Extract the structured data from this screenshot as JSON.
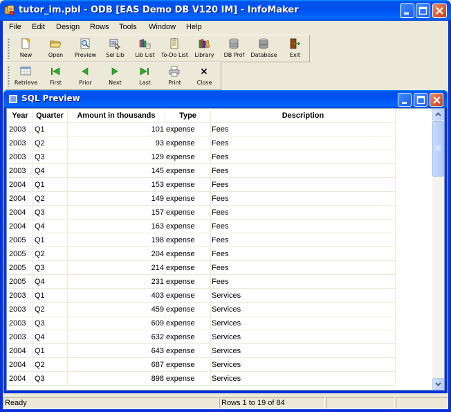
{
  "app": {
    "title": "tutor_im.pbl - ODB [EAS Demo DB V120 IM] - InfoMaker"
  },
  "menu": [
    "File",
    "Edit",
    "Design",
    "Rows",
    "Tools",
    "Window",
    "Help"
  ],
  "toolbar1": [
    {
      "label": "New",
      "icon": "new-icon"
    },
    {
      "label": "Open",
      "icon": "open-folder-icon"
    },
    {
      "label": "Preview",
      "icon": "preview-icon"
    },
    {
      "label": "Sel Lib",
      "icon": "select-library-icon"
    },
    {
      "label": "Lib List",
      "icon": "library-list-icon"
    },
    {
      "label": "To-Do List",
      "icon": "todo-list-icon"
    },
    {
      "label": "Library",
      "icon": "library-icon"
    },
    {
      "label": "DB Prof",
      "icon": "db-profile-icon"
    },
    {
      "label": "Database",
      "icon": "database-icon"
    },
    {
      "label": "Exit",
      "icon": "exit-door-icon"
    }
  ],
  "toolbar2": [
    {
      "label": "Retrieve",
      "icon": "retrieve-icon"
    },
    {
      "label": "First",
      "icon": "first-arrow-icon"
    },
    {
      "label": "Prior",
      "icon": "prior-arrow-icon"
    },
    {
      "label": "Next",
      "icon": "next-arrow-icon"
    },
    {
      "label": "Last",
      "icon": "last-arrow-icon"
    },
    {
      "label": "Print",
      "icon": "printer-icon"
    },
    {
      "label": "Close",
      "icon": "close-x-icon"
    }
  ],
  "child": {
    "title": "SQL Preview"
  },
  "grid": {
    "headers": [
      "Year",
      "Quarter",
      "Amount in thousands",
      "Type",
      "Description"
    ],
    "rows": [
      [
        "2003",
        "Q1",
        "101",
        "expense",
        "Fees"
      ],
      [
        "2003",
        "Q2",
        "93",
        "expense",
        "Fees"
      ],
      [
        "2003",
        "Q3",
        "129",
        "expense",
        "Fees"
      ],
      [
        "2003",
        "Q4",
        "145",
        "expense",
        "Fees"
      ],
      [
        "2004",
        "Q1",
        "153",
        "expense",
        "Fees"
      ],
      [
        "2004",
        "Q2",
        "149",
        "expense",
        "Fees"
      ],
      [
        "2004",
        "Q3",
        "157",
        "expense",
        "Fees"
      ],
      [
        "2004",
        "Q4",
        "163",
        "expense",
        "Fees"
      ],
      [
        "2005",
        "Q1",
        "198",
        "expense",
        "Fees"
      ],
      [
        "2005",
        "Q2",
        "204",
        "expense",
        "Fees"
      ],
      [
        "2005",
        "Q3",
        "214",
        "expense",
        "Fees"
      ],
      [
        "2005",
        "Q4",
        "231",
        "expense",
        "Fees"
      ],
      [
        "2003",
        "Q1",
        "403",
        "expense",
        "Services"
      ],
      [
        "2003",
        "Q2",
        "459",
        "expense",
        "Services"
      ],
      [
        "2003",
        "Q3",
        "609",
        "expense",
        "Services"
      ],
      [
        "2003",
        "Q4",
        "632",
        "expense",
        "Services"
      ],
      [
        "2004",
        "Q1",
        "643",
        "expense",
        "Services"
      ],
      [
        "2004",
        "Q2",
        "687",
        "expense",
        "Services"
      ],
      [
        "2004",
        "Q3",
        "898",
        "expense",
        "Services"
      ]
    ]
  },
  "status": {
    "ready": "Ready",
    "rows": "Rows 1 to 19 of 84",
    "pane3": "",
    "pane4": ""
  },
  "colors": {
    "titlebar": "#0054E3",
    "window_bg": "#ECE9D8",
    "close_button": "#C83D17"
  }
}
